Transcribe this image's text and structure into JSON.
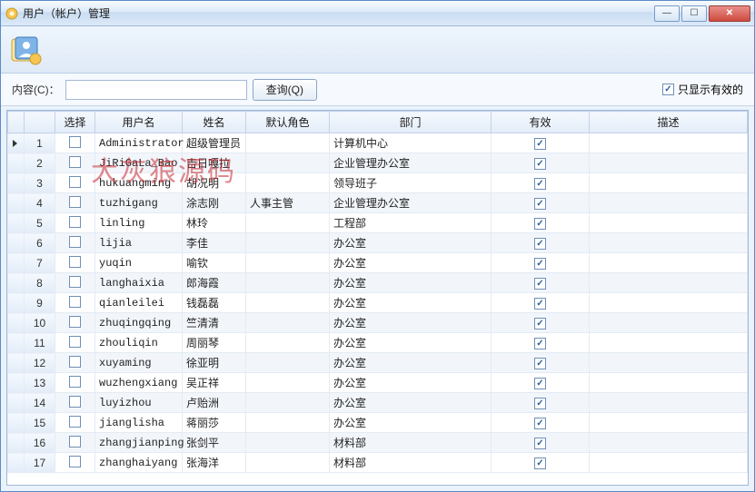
{
  "window": {
    "title": "用户（帐户）管理"
  },
  "filter": {
    "content_label": "内容(C)：",
    "search_value": "",
    "query_button": "查询(Q)",
    "show_valid_only_label": "只显示有效的",
    "show_valid_only_checked": true
  },
  "watermark": "大灰狼源码",
  "columns": {
    "rownum": "",
    "select": "选择",
    "username": "用户名",
    "realname": "姓名",
    "default_role": "默认角色",
    "department": "部门",
    "valid": "有效",
    "description": "描述"
  },
  "rows": [
    {
      "n": 1,
      "sel": false,
      "user": "Administrator",
      "name": "超级管理员",
      "role": "",
      "dept": "计算机中心",
      "valid": true,
      "desc": ""
    },
    {
      "n": 2,
      "sel": false,
      "user": "JiRiGaLa_Bao",
      "name": "吉日嘎拉",
      "role": "",
      "dept": "企业管理办公室",
      "valid": true,
      "desc": ""
    },
    {
      "n": 3,
      "sel": false,
      "user": "hukuangming",
      "name": "胡况明",
      "role": "",
      "dept": "领导班子",
      "valid": true,
      "desc": ""
    },
    {
      "n": 4,
      "sel": false,
      "user": "tuzhigang",
      "name": "涂志刚",
      "role": "人事主管",
      "dept": "企业管理办公室",
      "valid": true,
      "desc": ""
    },
    {
      "n": 5,
      "sel": false,
      "user": "linling",
      "name": "林玲",
      "role": "",
      "dept": "工程部",
      "valid": true,
      "desc": ""
    },
    {
      "n": 6,
      "sel": false,
      "user": "lijia",
      "name": "李佳",
      "role": "",
      "dept": "办公室",
      "valid": true,
      "desc": ""
    },
    {
      "n": 7,
      "sel": false,
      "user": "yuqin",
      "name": "喻钦",
      "role": "",
      "dept": "办公室",
      "valid": true,
      "desc": ""
    },
    {
      "n": 8,
      "sel": false,
      "user": "langhaixia",
      "name": "郎海霞",
      "role": "",
      "dept": "办公室",
      "valid": true,
      "desc": ""
    },
    {
      "n": 9,
      "sel": false,
      "user": "qianleilei",
      "name": "钱磊磊",
      "role": "",
      "dept": "办公室",
      "valid": true,
      "desc": ""
    },
    {
      "n": 10,
      "sel": false,
      "user": "zhuqingqing",
      "name": "竺清清",
      "role": "",
      "dept": "办公室",
      "valid": true,
      "desc": ""
    },
    {
      "n": 11,
      "sel": false,
      "user": "zhouliqin",
      "name": "周丽琴",
      "role": "",
      "dept": "办公室",
      "valid": true,
      "desc": ""
    },
    {
      "n": 12,
      "sel": false,
      "user": "xuyaming",
      "name": "徐亚明",
      "role": "",
      "dept": "办公室",
      "valid": true,
      "desc": ""
    },
    {
      "n": 13,
      "sel": false,
      "user": "wuzhengxiang",
      "name": "吴正祥",
      "role": "",
      "dept": "办公室",
      "valid": true,
      "desc": ""
    },
    {
      "n": 14,
      "sel": false,
      "user": "luyizhou",
      "name": "卢贻洲",
      "role": "",
      "dept": "办公室",
      "valid": true,
      "desc": ""
    },
    {
      "n": 15,
      "sel": false,
      "user": "jianglisha",
      "name": "蒋丽莎",
      "role": "",
      "dept": "办公室",
      "valid": true,
      "desc": ""
    },
    {
      "n": 16,
      "sel": false,
      "user": "zhangjianping",
      "name": "张剑平",
      "role": "",
      "dept": "材料部",
      "valid": true,
      "desc": ""
    },
    {
      "n": 17,
      "sel": false,
      "user": "zhanghaiyang",
      "name": "张海洋",
      "role": "",
      "dept": "材料部",
      "valid": true,
      "desc": ""
    }
  ]
}
